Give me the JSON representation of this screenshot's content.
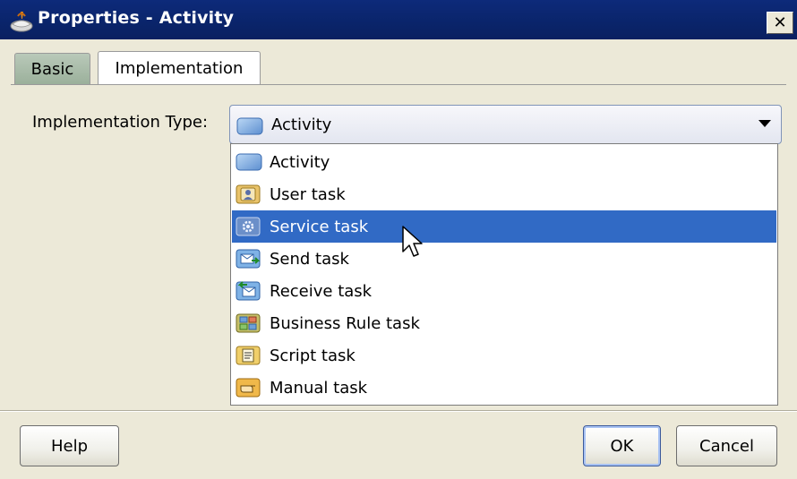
{
  "window": {
    "title": "Properties - Activity",
    "close_label": "✕"
  },
  "tabs": [
    {
      "label": "Basic",
      "selected": false
    },
    {
      "label": "Implementation",
      "selected": true
    }
  ],
  "implementation_type": {
    "label": "Implementation Type:",
    "value": "Activity",
    "options": [
      {
        "label": "Activity",
        "icon": "activity-icon"
      },
      {
        "label": "User task",
        "icon": "user-task-icon"
      },
      {
        "label": "Service task",
        "icon": "service-task-icon",
        "highlighted": true
      },
      {
        "label": "Send task",
        "icon": "send-task-icon"
      },
      {
        "label": "Receive task",
        "icon": "receive-task-icon"
      },
      {
        "label": "Business Rule task",
        "icon": "business-rule-task-icon"
      },
      {
        "label": "Script task",
        "icon": "script-task-icon"
      },
      {
        "label": "Manual task",
        "icon": "manual-task-icon"
      }
    ]
  },
  "buttons": {
    "help": "Help",
    "ok": "OK",
    "cancel": "Cancel"
  },
  "colors": {
    "titlebar": "#0a246a",
    "selection": "#316ac5",
    "dialog_bg": "#ece9d8"
  }
}
